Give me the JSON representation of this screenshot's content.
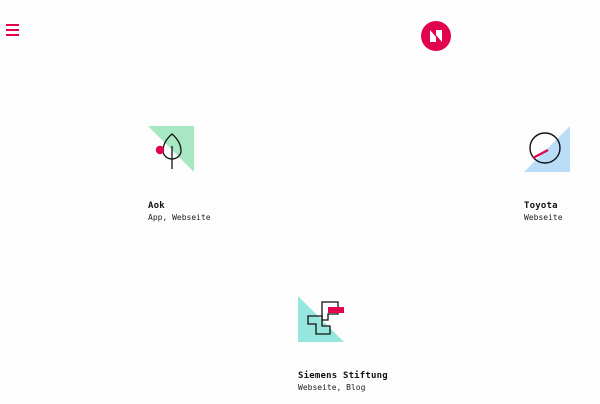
{
  "header": {
    "menu_icon": "hamburger-menu-icon",
    "logo_icon": "n-logo-icon",
    "accent_color": "#e2034f"
  },
  "projects": [
    {
      "title": "Aok",
      "tags": "App, Webseite",
      "icon": "tree-icon",
      "color": "#a7e8c3"
    },
    {
      "title": "Toyota",
      "tags": "Webseite",
      "icon": "speedometer-icon",
      "color": "#b9dcf7"
    },
    {
      "title": "Siemens Stiftung",
      "tags": "Webseite, Blog",
      "icon": "interlocking-shapes-icon",
      "color": "#97e6de"
    }
  ]
}
